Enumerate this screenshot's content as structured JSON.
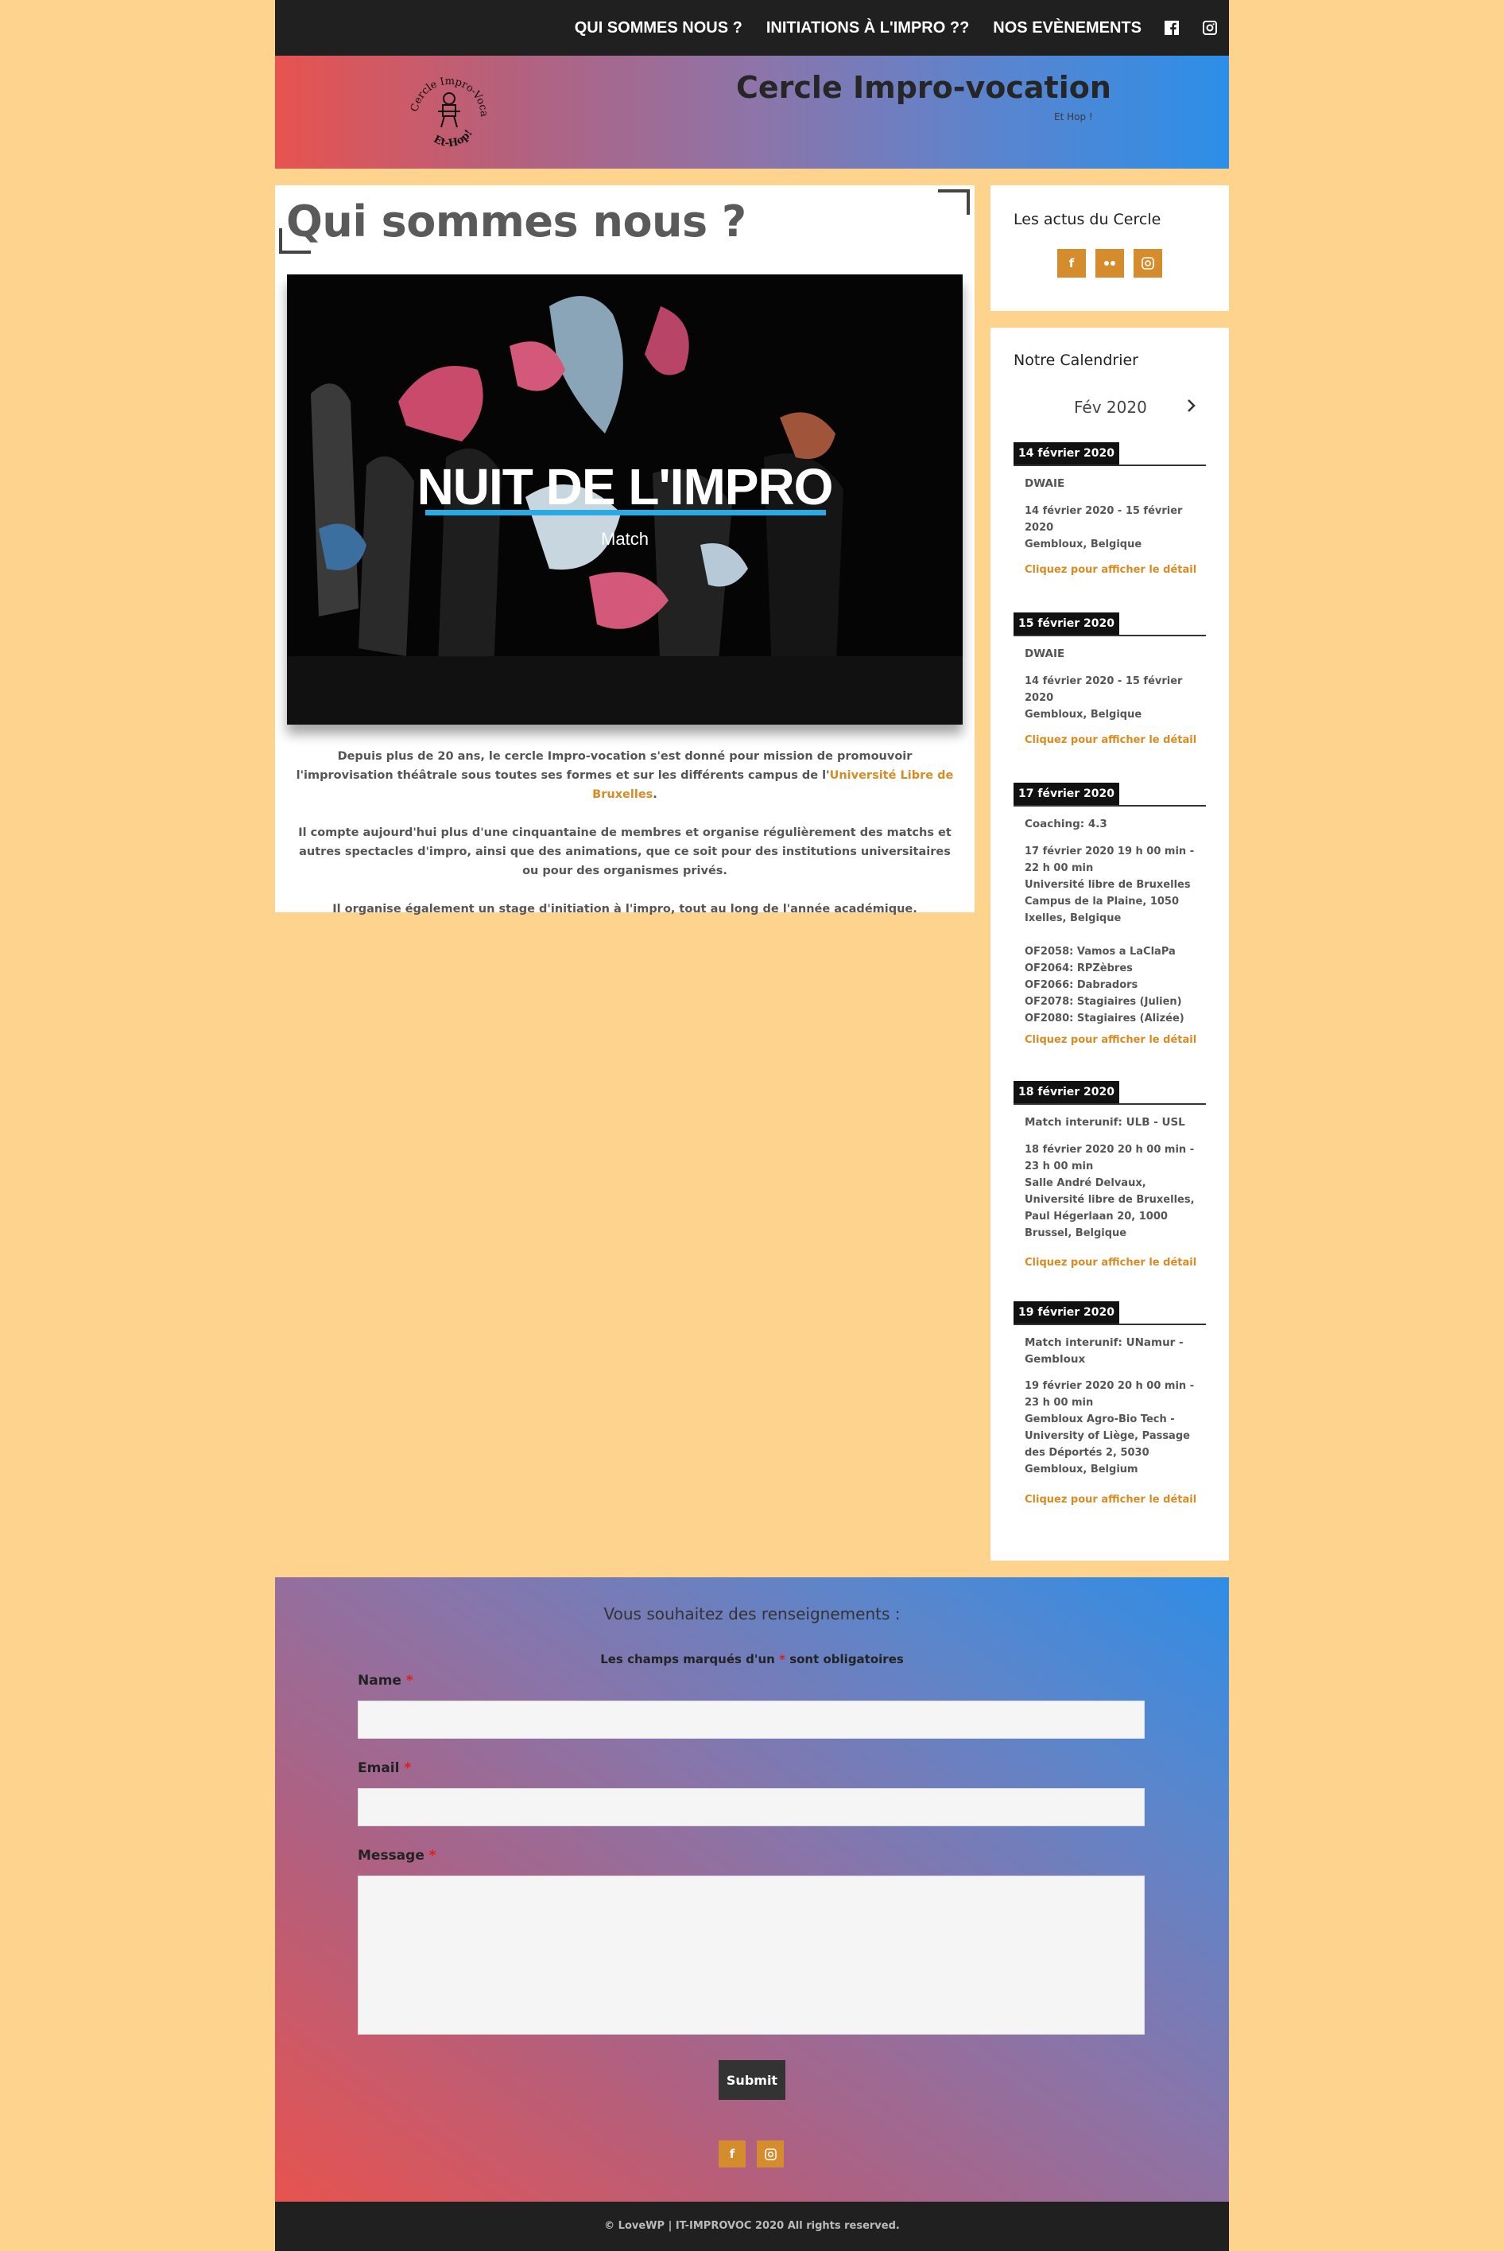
{
  "nav": {
    "items": [
      "QUI SOMMES NOUS ?",
      "INITIATIONS À L'IMPRO ??",
      "NOS EVÈNEMENTS"
    ],
    "social_icons": [
      "facebook-icon",
      "instagram-icon"
    ]
  },
  "header": {
    "title": "Cercle Impro-vocation",
    "tagline": "Et Hop !",
    "logo_text_top": "Cercle Impro-Vocation",
    "logo_text_bottom": "Et-Hop!"
  },
  "main": {
    "title": "Qui sommes nous ?",
    "hero_title": "NUIT DE L'IMPRO",
    "hero_subtitle": "Match",
    "paragraph1_before": "Depuis plus de 20 ans, le cercle Impro-vocation s'est donné pour mission de promouvoir l'improvisation théâtrale sous toutes ses formes et sur les différents campus de l'",
    "paragraph1_link": "Université Libre de Bruxelles",
    "paragraph1_after": ".",
    "paragraph2": "Il compte aujourd'hui plus d'une cinquantaine de membres et organise régulièrement des matchs et autres spectacles d'impro, ainsi que des animations, que ce soit pour des institutions universitaires ou pour des organismes privés.",
    "paragraph3": "Il organise également un stage d'initiation à l'impro, tout au long de l'année académique."
  },
  "sidebar": {
    "news_title": "Les actus du Cercle",
    "news_icons": [
      "facebook-icon",
      "flickr-icon",
      "instagram-icon"
    ],
    "calendar_title": "Notre Calendrier",
    "month": "Fév 2020",
    "details_link": "Cliquez pour afficher le détail",
    "events": [
      {
        "date": "14 février 2020",
        "title": "DWAIE",
        "details": "14 février 2020 - 15 février 2020\nGembloux, Belgique"
      },
      {
        "date": "15 février 2020",
        "title": "DWAIE",
        "details": "14 février 2020 - 15 février 2020\nGembloux, Belgique"
      },
      {
        "date": "17 février 2020",
        "title": "Coaching: 4.3",
        "details": "17 février 2020  19 h 00 min - 22 h 00 min\nUniversité libre de Bruxelles Campus de la Plaine, 1050 Ixelles, Belgique\n\nOF2058: Vamos a LaClaPa\nOF2064: RPZèbres\nOF2066: Dabradors\nOF2078: Stagiaires (Julien)\nOF2080: Stagiaires (Alizée)"
      },
      {
        "date": "18 février 2020",
        "title": "Match interunif: ULB - USL",
        "details": "18 février 2020  20 h 00 min - 23 h 00 min\nSalle André Delvaux, Université libre de Bruxelles, Paul Hégerlaan 20, 1000 Brussel, Belgique"
      },
      {
        "date": "19 février 2020",
        "title": "Match interunif: UNamur - Gembloux",
        "details": "19 février 2020  20 h 00 min - 23 h 00 min\nGembloux Agro-Bio Tech - University of Liège, Passage des Déportés 2, 5030 Gembloux, Belgium"
      }
    ]
  },
  "contact": {
    "title": "Vous souhaitez des renseignements :",
    "note_before": "Les champs marqués d'un",
    "note_star": "*",
    "note_after": "sont obligatoires",
    "name_label": "Name",
    "email_label": "Email",
    "message_label": "Message",
    "required_mark": "*",
    "submit_label": "Submit",
    "social_icons": [
      "facebook-icon",
      "instagram-icon"
    ]
  },
  "footer": {
    "copyright": "© LoveWP | IT-IMPROVOC 2020 All rights reserved."
  },
  "colors": {
    "background": "#fed38e",
    "accent": "#d98b22",
    "dark": "#202020",
    "hero_underline": "#2aaae2"
  }
}
